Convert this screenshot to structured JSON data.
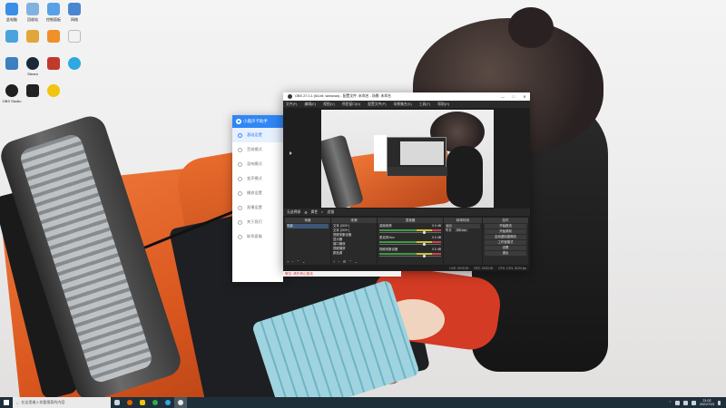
{
  "desktop": {
    "icons": [
      {
        "label": "此电脑",
        "color": "#3a8ee6",
        "icon": "computer-icon"
      },
      {
        "label": "回收站",
        "color": "#7fb2df",
        "icon": "recycle-bin-icon"
      },
      {
        "label": "控制面板",
        "color": "#5aa0e8",
        "icon": "control-panel-icon"
      },
      {
        "label": "网络",
        "color": "#4a86d0",
        "icon": "network-icon"
      },
      {
        "label": "Steam",
        "color": "#1b2838",
        "icon": "steam-icon"
      },
      {
        "label": "OBS Studio",
        "color": "#202020",
        "icon": "obs-icon"
      }
    ]
  },
  "tool_app": {
    "title": "小鹿声卡助手",
    "items": [
      {
        "label": "基础设置",
        "icon": "settings-icon"
      },
      {
        "label": "音效模式",
        "icon": "effect-icon"
      },
      {
        "label": "混响模式",
        "icon": "reverb-icon"
      },
      {
        "label": "变声模式",
        "icon": "voice-icon"
      },
      {
        "label": "播放设置",
        "icon": "playback-icon"
      },
      {
        "label": "直播设置",
        "icon": "live-icon"
      },
      {
        "label": "关于我们",
        "icon": "about-icon"
      },
      {
        "label": "联系客服",
        "icon": "support-icon"
      }
    ],
    "active_index": 0
  },
  "obs": {
    "title": "OBS 27.0.1 (64-bit, windows) - 配置文件: 未命名 - 场景: 未命名",
    "menu": [
      "文件(F)",
      "编辑(E)",
      "视图(V)",
      "停靠窗口(D)",
      "配置文件(P)",
      "场景集合(S)",
      "工具(T)",
      "帮助(H)"
    ],
    "toolbar": {
      "source_label": "无选择源",
      "properties_label": "属性",
      "filters_label": "滤镜"
    },
    "docks": {
      "scenes": {
        "header": "场景",
        "items": [
          "场景"
        ]
      },
      "sources": {
        "header": "来源",
        "items": [
          "文本 (GDI+)",
          "文本 (GDI+)",
          "视频采集设备",
          "显示器",
          "窗口捕获",
          "视频捕获",
          "颜色源"
        ]
      },
      "mixer": {
        "header": "混音器",
        "channels": [
          {
            "name": "桌面音频",
            "db": "0.0 dB"
          },
          {
            "name": "麦克风/Aux",
            "db": "0.0 dB"
          },
          {
            "name": "视频采集设备",
            "db": "0.0 dB"
          }
        ]
      },
      "transitions": {
        "header": "转场特效",
        "mode": "淡出",
        "duration_label": "时长",
        "duration": "300 ms"
      },
      "controls": {
        "header": "控件",
        "buttons": [
          "开始推流",
          "开始录制",
          "启动虚拟摄像机",
          "工作室模式",
          "设置",
          "退出"
        ]
      }
    },
    "status": [
      "LIVE: 00:00:00",
      "REC: 00:00:00",
      "CPU: 2.3%, 30.00 fps"
    ],
    "warning": "警告: 请先停止推流"
  },
  "taskbar": {
    "search_placeholder": "在这里输入你要搜索的内容",
    "apps": [
      {
        "icon": "task-view-icon",
        "color": "#cfd6db"
      },
      {
        "icon": "firefox-icon",
        "color": "#e66000"
      },
      {
        "icon": "file-explorer-icon",
        "color": "#f1c40f"
      },
      {
        "icon": "chrome-icon",
        "color": "#34a853"
      },
      {
        "icon": "edge-icon",
        "color": "#2ea9e0"
      },
      {
        "icon": "obs-icon",
        "color": "#e6e6e6"
      }
    ],
    "clock_time": "21:02",
    "clock_date": "2021/7/23"
  }
}
